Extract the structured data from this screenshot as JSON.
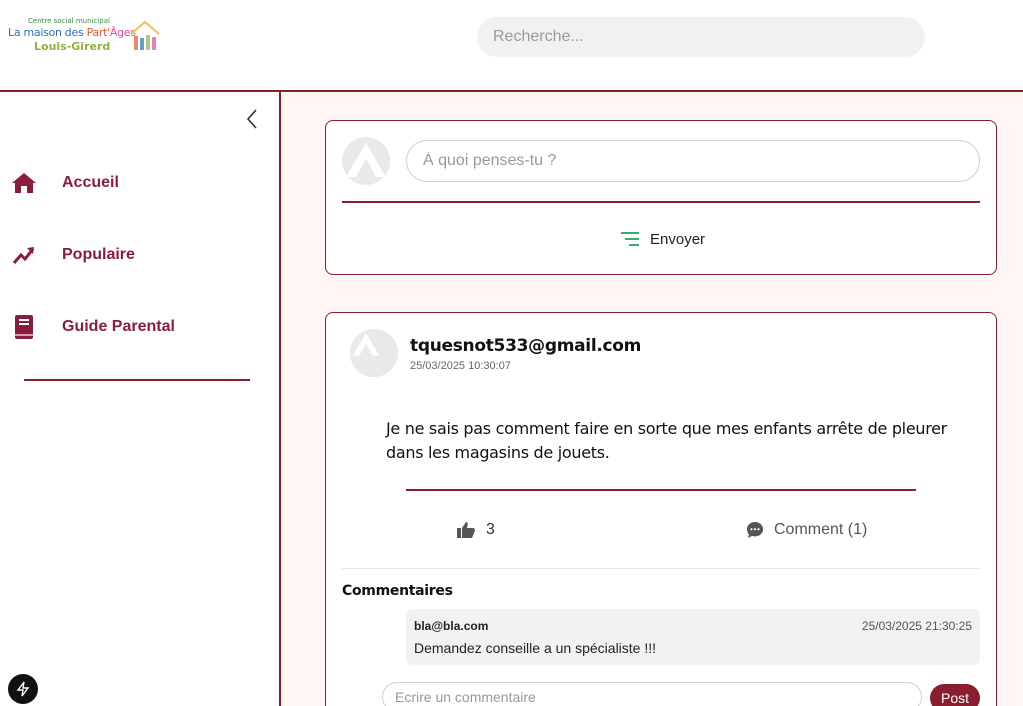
{
  "header": {
    "logo": {
      "line1": "Centre social municipal",
      "line2_a": "La maison des ",
      "line2_b": "Part'",
      "line2_c": "Âges",
      "line3": "Louis-Girerd"
    },
    "search": {
      "placeholder": "Recherche..."
    }
  },
  "sidebar": {
    "items": [
      {
        "label": "Accueil",
        "icon": "home-icon"
      },
      {
        "label": "Populaire",
        "icon": "trending-icon"
      },
      {
        "label": "Guide Parental",
        "icon": "book-icon"
      }
    ]
  },
  "composer": {
    "placeholder": "À quoi penses-tu ?",
    "send_label": "Envoyer"
  },
  "post": {
    "author": "tquesnot533@gmail.com",
    "date": "25/03/2025 10:30:07",
    "body": "Je ne sais pas comment faire en sorte que mes enfants arrête de pleurer dans les magasins de jouets.",
    "likes": "3",
    "comment_label": "Comment (1)",
    "comments_title": "Commentaires",
    "comments": [
      {
        "author": "bla@bla.com",
        "date": "25/03/2025 21:30:25",
        "text": "Demandez conseille a un spécialiste !!!"
      }
    ],
    "new_comment_placeholder": "Ecrire un commentaire",
    "post_button": "Post"
  },
  "colors": {
    "accent": "#8a1d2e",
    "nav_text": "#8a1d3e",
    "send_icon": "#2fb36a"
  }
}
